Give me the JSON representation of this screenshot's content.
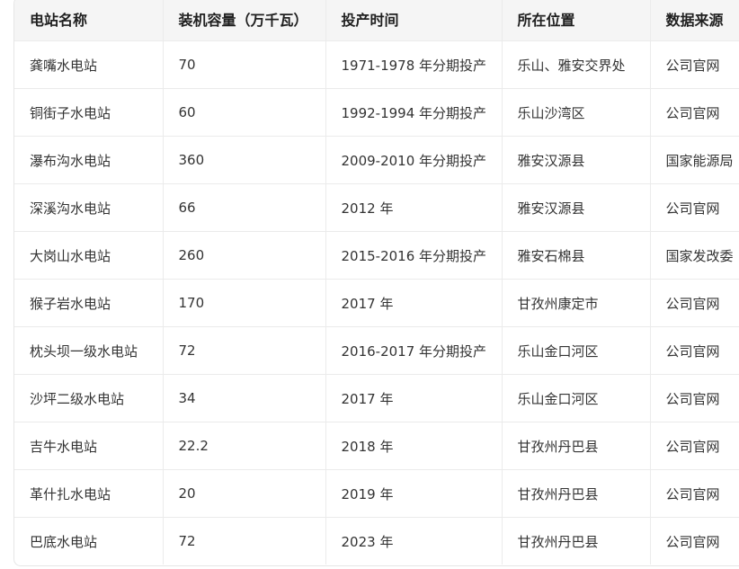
{
  "table": {
    "headers": [
      "电站名称",
      "装机容量（万千瓦）",
      "投产时间",
      "所在位置",
      "数据来源"
    ],
    "rows": [
      [
        "龚嘴水电站",
        "70",
        "1971-1978 年分期投产",
        "乐山、雅安交界处",
        "公司官网"
      ],
      [
        "铜街子水电站",
        "60",
        "1992-1994 年分期投产",
        "乐山沙湾区",
        "公司官网"
      ],
      [
        "瀑布沟水电站",
        "360",
        "2009-2010 年分期投产",
        "雅安汉源县",
        "国家能源局"
      ],
      [
        "深溪沟水电站",
        "66",
        "2012 年",
        "雅安汉源县",
        "公司官网"
      ],
      [
        "大岗山水电站",
        "260",
        "2015-2016 年分期投产",
        "雅安石棉县",
        "国家发改委"
      ],
      [
        "猴子岩水电站",
        "170",
        "2017 年",
        "甘孜州康定市",
        "公司官网"
      ],
      [
        "枕头坝一级水电站",
        "72",
        "2016-2017 年分期投产",
        "乐山金口河区",
        "公司官网"
      ],
      [
        "沙坪二级水电站",
        "34",
        "2017 年",
        "乐山金口河区",
        "公司官网"
      ],
      [
        "吉牛水电站",
        "22.2",
        "2018 年",
        "甘孜州丹巴县",
        "公司官网"
      ],
      [
        "革什扎水电站",
        "20",
        "2019 年",
        "甘孜州丹巴县",
        "公司官网"
      ],
      [
        "巴底水电站",
        "72",
        "2023 年",
        "甘孜州丹巴县",
        "公司官网"
      ]
    ]
  }
}
